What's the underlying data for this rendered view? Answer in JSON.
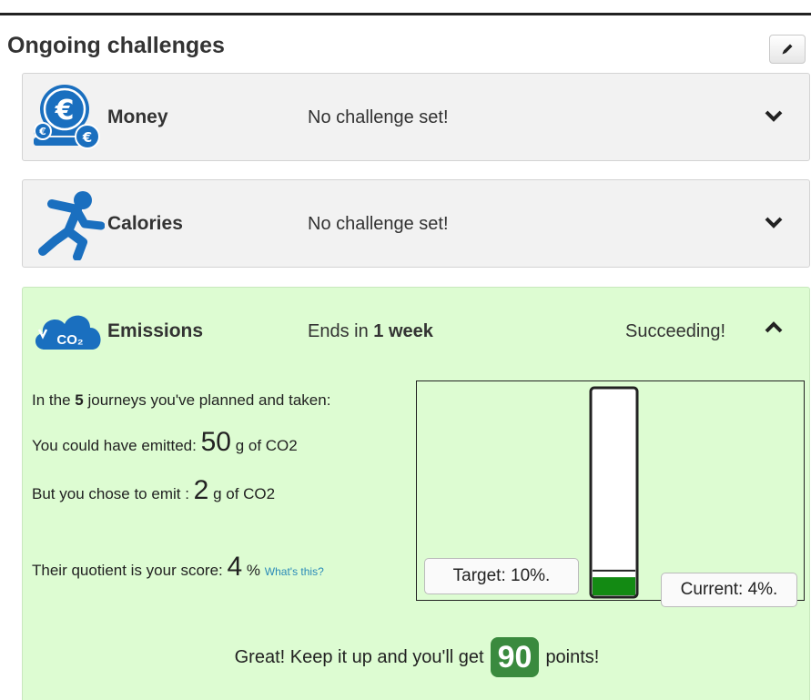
{
  "header": {
    "title": "Ongoing challenges",
    "edit_icon": "pencil-icon"
  },
  "challenges": {
    "money": {
      "icon": "euro-coins-icon",
      "name": "Money",
      "status": "No challenge set!",
      "toggle_icon": "chevron-down-icon"
    },
    "calories": {
      "icon": "running-person-icon",
      "name": "Calories",
      "status": "No challenge set!",
      "toggle_icon": "chevron-down-icon"
    },
    "emissions": {
      "icon": "co2-cloud-icon",
      "icon_text": "CO₂",
      "name": "Emissions",
      "ends_prefix": "Ends in",
      "ends_value": "1 week",
      "result": "Succeeding!",
      "toggle_icon": "chevron-up-icon",
      "details": {
        "journeys_prefix": "In the",
        "journeys_count": "5",
        "journeys_suffix": "journeys you've planned and taken:",
        "could_prefix": "You could have emitted:",
        "could_value": "50",
        "could_unit": "g of CO2",
        "chose_prefix": "But you chose to emit :",
        "chose_value": "2",
        "chose_unit": "g of CO2",
        "quotient_prefix": "Their quotient is your score:",
        "quotient_value": "4",
        "quotient_unit": "%",
        "whats_this": "What's this?"
      },
      "gauge": {
        "target_label": "Target: 10%.",
        "current_label": "Current: 4%.",
        "target_fraction": 0.1,
        "current_fraction": 0.04
      },
      "footer": {
        "prefix": "Great! Keep it up and you'll get",
        "points": "90",
        "suffix": "points!"
      }
    }
  },
  "colors": {
    "panel_gray": "#f2f2f2",
    "success_bg": "#ddfcd2",
    "icon_blue": "#1a6fbf",
    "gauge_fill": "#138a13",
    "badge_green": "#3a8a3e",
    "link_blue": "#2a8ab8"
  }
}
